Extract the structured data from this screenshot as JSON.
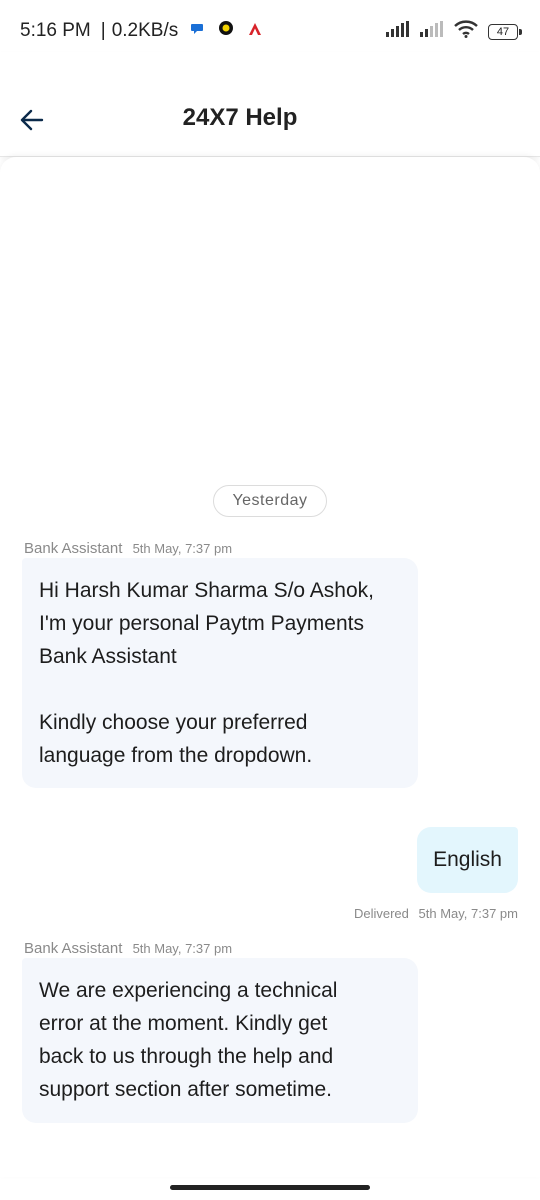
{
  "status_bar": {
    "time": "5:16 PM",
    "separator": "|",
    "speed": "0.2KB/s",
    "battery": "47",
    "icons": [
      "chat-bubble-icon",
      "circle-app-icon",
      "triangle-app-icon",
      "signal-icon",
      "signal-weak-icon",
      "wifi-icon",
      "battery-icon"
    ]
  },
  "header": {
    "title": "24X7 Help",
    "back_icon": "back-arrow-icon"
  },
  "chat": {
    "date_chip": "Yesterday",
    "messages": [
      {
        "sender": "Bank Assistant",
        "time": "5th May, 7:37 pm",
        "lines": [
          "Hi Harsh Kumar Sharma S/o Ashok,",
          "I'm your personal Paytm Payments",
          "Bank Assistant"
        ],
        "lines2": [
          "Kindly choose your preferred",
          "language from the dropdown."
        ]
      },
      {
        "sender": "me",
        "text": "English",
        "status": "Delivered",
        "time": "5th May, 7:37 pm"
      },
      {
        "sender": "Bank Assistant",
        "time": "5th May, 7:37 pm",
        "lines": [
          "We are experiencing a technical",
          "error at the moment. Kindly get",
          "back to us through the help and",
          "support section after sometime."
        ]
      }
    ]
  },
  "colors": {
    "incoming_bubble": "#f4f7fc",
    "outgoing_bubble": "#e3f6fd",
    "back_arrow": "#0b2a4a"
  }
}
